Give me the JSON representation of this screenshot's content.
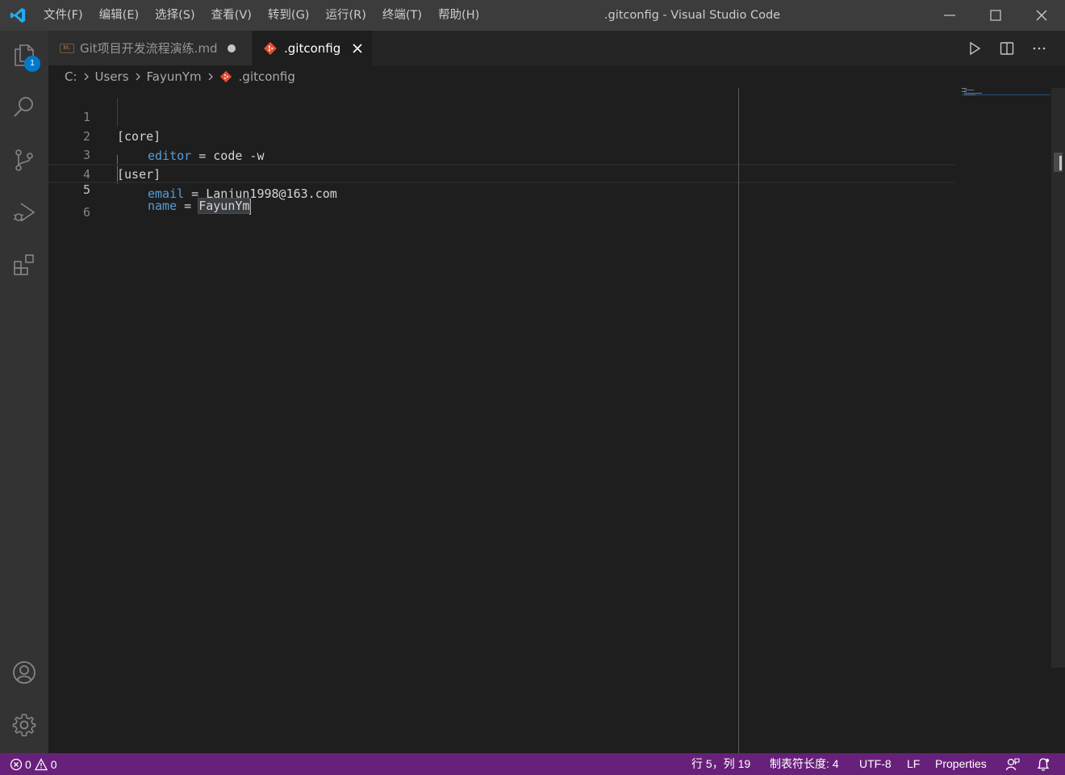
{
  "window": {
    "title": ".gitconfig - Visual Studio Code"
  },
  "menu": [
    "文件(F)",
    "编辑(E)",
    "选择(S)",
    "查看(V)",
    "转到(G)",
    "运行(R)",
    "终端(T)",
    "帮助(H)"
  ],
  "activity_bar": {
    "explorer_badge": "1",
    "items": [
      "explorer-icon",
      "search-icon",
      "source-control-icon",
      "run-debug-icon",
      "extensions-icon",
      "account-icon",
      "settings-gear-icon"
    ]
  },
  "tabs": [
    {
      "label": "Git项目开发流程演练.md",
      "active": false,
      "dirty": true,
      "icon": "markdown-icon"
    },
    {
      "label": ".gitconfig",
      "active": true,
      "dirty": false,
      "icon": "git-icon"
    }
  ],
  "breadcrumb": [
    "C:",
    "Users",
    "FayunYm",
    ".gitconfig"
  ],
  "editor": {
    "line_numbers": [
      "1",
      "2",
      "3",
      "4",
      "5",
      "6"
    ],
    "lines": {
      "l1": "[core]",
      "l2_key": "editor",
      "l2_eq": " = ",
      "l2_val": "code -w",
      "l3": "[user]",
      "l4_key": "email",
      "l4_eq": " = ",
      "l4_val": "Lanjun1998@163.com",
      "l5_key": "name",
      "l5_eq": " = ",
      "l5_val": "FayunYm"
    },
    "current_line": 5
  },
  "status_bar": {
    "errors": "0",
    "warnings": "0",
    "position": "行 5，列 19",
    "tab_size": "制表符长度: 4",
    "encoding": "UTF-8",
    "eol": "LF",
    "language": "Properties"
  },
  "colors": {
    "status_bar": "#68217a",
    "accent": "#007acc",
    "keyword": "#569cd6"
  }
}
